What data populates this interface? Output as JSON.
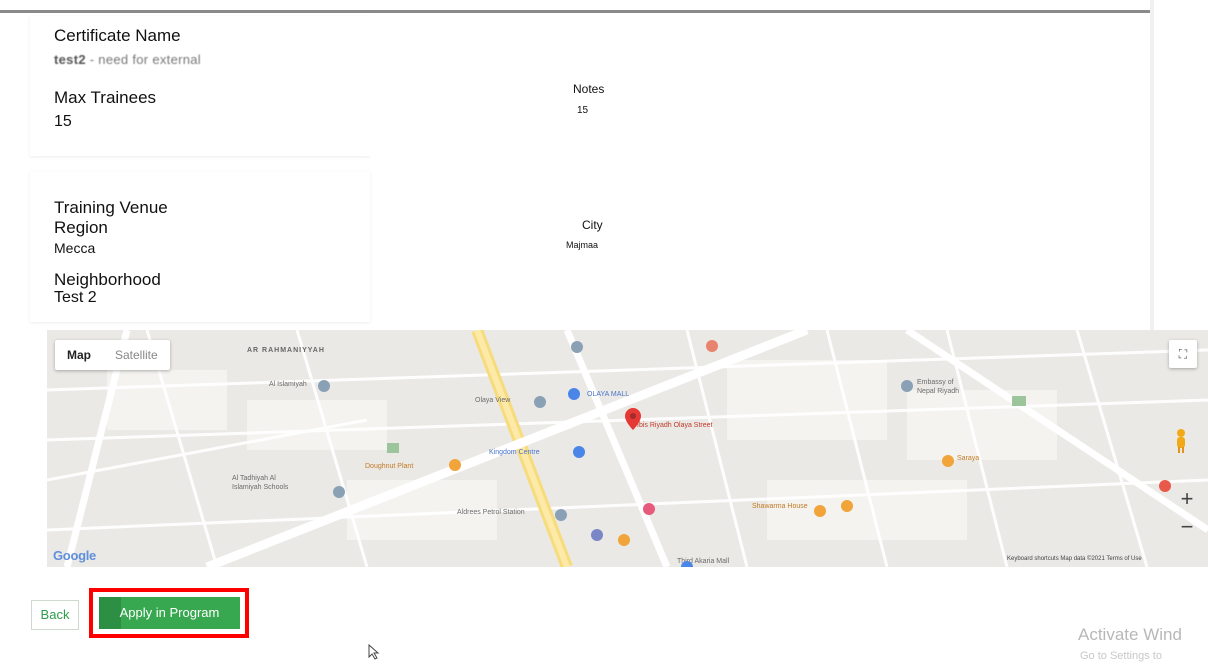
{
  "certificate": {
    "name_label": "Certificate Name",
    "name_value_a": "test2",
    "name_value_b": " - need for external",
    "max_trainees_label": "Max Trainees",
    "max_trainees_value": "15",
    "notes_label": "Notes",
    "notes_value": "15"
  },
  "venue": {
    "section_label": "Training Venue",
    "region_label": "Region",
    "region_value": "Mecca",
    "city_label": "City",
    "city_value": "Majmaa",
    "neighborhood_label": "Neighborhood",
    "neighborhood_value": "Test 2"
  },
  "map": {
    "type_map": "Map",
    "type_satellite": "Satellite",
    "provider": "Google",
    "attribution": "Keyboard shortcuts   Map data ©2021   Terms of Use",
    "district_label": "AR RAHMANIYYAH",
    "place_labels": [
      "Embassy of Nepal Riyadh",
      "OLAYA MALL",
      "Olaya View",
      "Ibis Riyadh Olaya Street",
      "Kingdom Centre",
      "Al Tadhiyah Al Islamiyah Schools",
      "Aldrees Petrol Station",
      "Shawarma House",
      "Third Akaria Mall",
      "Doughnut Plant"
    ],
    "zoom_in": "+",
    "zoom_out": "−"
  },
  "actions": {
    "back_label": "Back",
    "apply_label": "Apply in Program"
  },
  "os_watermark": {
    "line1": "Activate Wind",
    "line2": "Go to Settings to"
  }
}
